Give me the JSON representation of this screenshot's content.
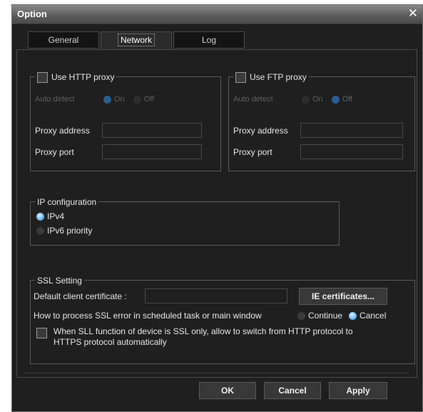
{
  "window": {
    "title": "Option"
  },
  "tabs": [
    {
      "label": "General",
      "active": false
    },
    {
      "label": "Network",
      "active": true
    },
    {
      "label": "Log",
      "active": false
    }
  ],
  "http_proxy": {
    "label": "Use HTTP proxy",
    "checked": false,
    "auto_detect_label": "Auto detect",
    "on_label": "On",
    "off_label": "Off",
    "auto_detect_value": "On",
    "address_label": "Proxy address",
    "address_value": "",
    "port_label": "Proxy port",
    "port_value": ""
  },
  "ftp_proxy": {
    "label": "Use FTP proxy",
    "checked": false,
    "auto_detect_label": "Auto detect",
    "on_label": "On",
    "off_label": "Off",
    "auto_detect_value": "Off",
    "address_label": "Proxy address",
    "address_value": "",
    "port_label": "Proxy port",
    "port_value": ""
  },
  "ip_config": {
    "title": "IP configuration",
    "options": [
      "IPv4",
      "IPv6 priority"
    ],
    "selected": "IPv4"
  },
  "ssl": {
    "title": "SSL Setting",
    "client_cert_label": "Default client certificate :",
    "client_cert_value": "",
    "ie_cert_button": "IE certificates...",
    "error_label": "How to process SSL error in scheduled task or main window",
    "continue_label": "Continue",
    "cancel_label": "Cancel",
    "error_choice": "Cancel",
    "auto_switch_label_line1": "When SLL function of device is SSL only, allow to switch from HTTP protocol  to",
    "auto_switch_label_line2": "HTTPS protocol automatically",
    "auto_switch_checked": false
  },
  "footer": {
    "ok_label": "OK",
    "cancel_label": "Cancel",
    "apply_label": "Apply"
  },
  "colors": {
    "accent": "#3a9aec",
    "window_bg": "#1f1f1f",
    "titlebar": "#6e6e6e"
  }
}
